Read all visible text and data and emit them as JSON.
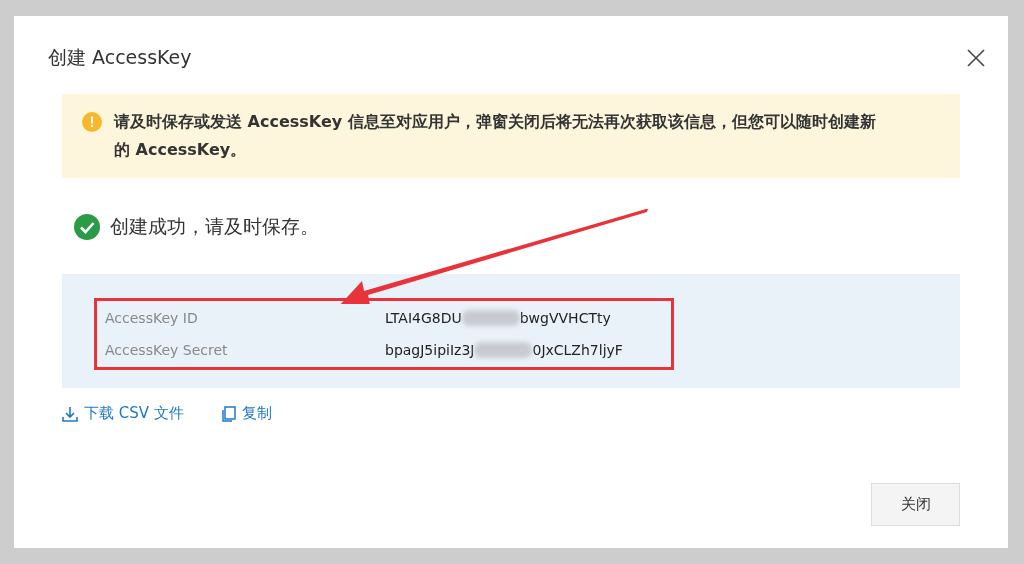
{
  "dialog": {
    "title": "创建 AccessKey",
    "alert": "请及时保存或发送 AccessKey 信息至对应用户，弹窗关闭后将无法再次获取该信息，但您可以随时创建新的 AccessKey。",
    "success": "创建成功，请及时保存。",
    "keys": [
      {
        "label": "AccessKey ID",
        "value_start": "LTAI4G8DU",
        "value_end": "bwgVVHCTty"
      },
      {
        "label": "AccessKey Secret",
        "value_start": "bpagJ5ipiIz3J",
        "value_end": "0JxCLZh7ljyF"
      }
    ],
    "actions": [
      "下载 CSV 文件",
      "复制"
    ],
    "close_button": "关闭"
  }
}
